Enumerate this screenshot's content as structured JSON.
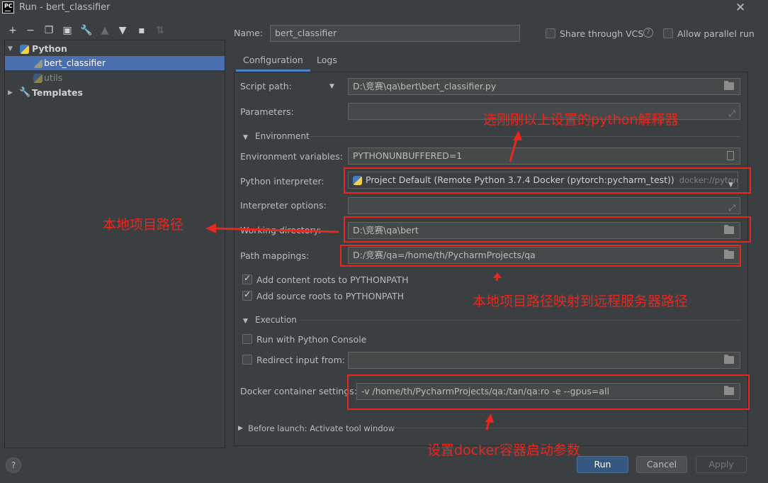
{
  "window": {
    "title": "Run - bert_classifier"
  },
  "tree": {
    "items": [
      {
        "label": "Python"
      },
      {
        "label": "bert_classifier"
      },
      {
        "label": "utils"
      },
      {
        "label": "Templates"
      }
    ]
  },
  "header": {
    "name_label": "Name:",
    "name_value": "bert_classifier",
    "share_vcs_label": "Share through VCS",
    "allow_parallel_label": "Allow parallel run"
  },
  "tabs": [
    {
      "label": "Configuration"
    },
    {
      "label": "Logs"
    }
  ],
  "config": {
    "script_path_label": "Script path:",
    "script_path_value": "D:\\竞赛\\qa\\bert\\bert_classifier.py",
    "parameters_label": "Parameters:",
    "environment_section": "Environment",
    "env_vars_label": "Environment variables:",
    "env_vars_value": "PYTHONUNBUFFERED=1",
    "interpreter_label": "Python interpreter:",
    "interpreter_value": "Project Default (Remote Python 3.7.4 Docker (pytorch:pycharm_test))",
    "interpreter_hint": "docker://pytorch:py",
    "interpreter_options_label": "Interpreter options:",
    "working_dir_label": "Working directory:",
    "working_dir_value": "D:\\竞赛\\qa\\bert",
    "path_mappings_label": "Path mappings:",
    "path_mappings_value": "D:/竞赛/qa=/home/th/PycharmProjects/qa",
    "add_content_roots_label": "Add content roots to PYTHONPATH",
    "add_source_roots_label": "Add source roots to PYTHONPATH",
    "execution_section": "Execution",
    "run_console_label": "Run with Python Console",
    "redirect_input_label": "Redirect input from:",
    "docker_settings_label": "Docker container settings:",
    "docker_settings_value": "-v /home/th/PycharmProjects/qa:/tan/qa:ro -e --gpus=all",
    "before_launch_label": "Before launch: Activate tool window"
  },
  "footer": {
    "run_label": "Run",
    "cancel_label": "Cancel",
    "apply_label": "Apply",
    "help_label": "?"
  },
  "annotations": {
    "interpreter_note": "选刚刚以上设置的python解释器",
    "local_path_note": "本地项目路径",
    "mapping_note": "本地项目路径映射到远程服务器路径",
    "docker_note": "设置docker容器启动参数"
  },
  "colors": {
    "accent": "#4b6eaf",
    "annotation": "#e8271e",
    "primary_button": "#365880"
  }
}
